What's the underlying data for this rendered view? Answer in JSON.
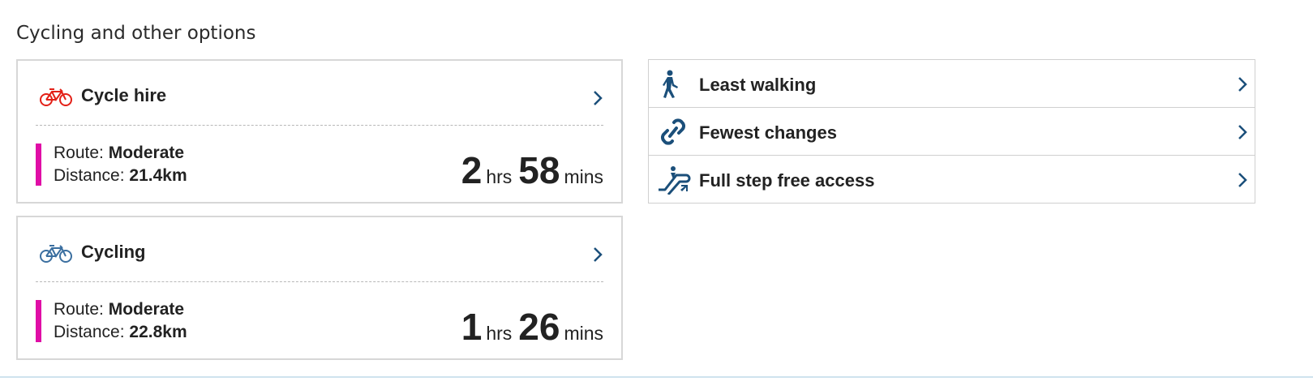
{
  "section": {
    "title": "Cycling and other options"
  },
  "cards": [
    {
      "label": "Cycle hire",
      "icon": "cycle-hire-icon",
      "icon_color": "#e32017",
      "route_label": "Route:",
      "route_value": "Moderate",
      "distance_label": "Distance:",
      "distance_value": "21.4km",
      "hours": "2",
      "hours_unit": "hrs",
      "mins": "58",
      "mins_unit": "mins"
    },
    {
      "label": "Cycling",
      "icon": "bicycle-icon",
      "icon_color": "#3b6fa0",
      "route_label": "Route:",
      "route_value": "Moderate",
      "distance_label": "Distance:",
      "distance_value": "22.8km",
      "hours": "1",
      "hours_unit": "hrs",
      "mins": "26",
      "mins_unit": "mins"
    }
  ],
  "options": [
    {
      "label": "Least walking",
      "icon": "walking-person-icon"
    },
    {
      "label": "Fewest changes",
      "icon": "link-chain-icon"
    },
    {
      "label": "Full step free access",
      "icon": "escalator-step-free-icon"
    }
  ],
  "colors": {
    "route_bar": "#e00ea6",
    "icon_blue": "#1b4f7a",
    "chevron": "#1b4f7a"
  }
}
